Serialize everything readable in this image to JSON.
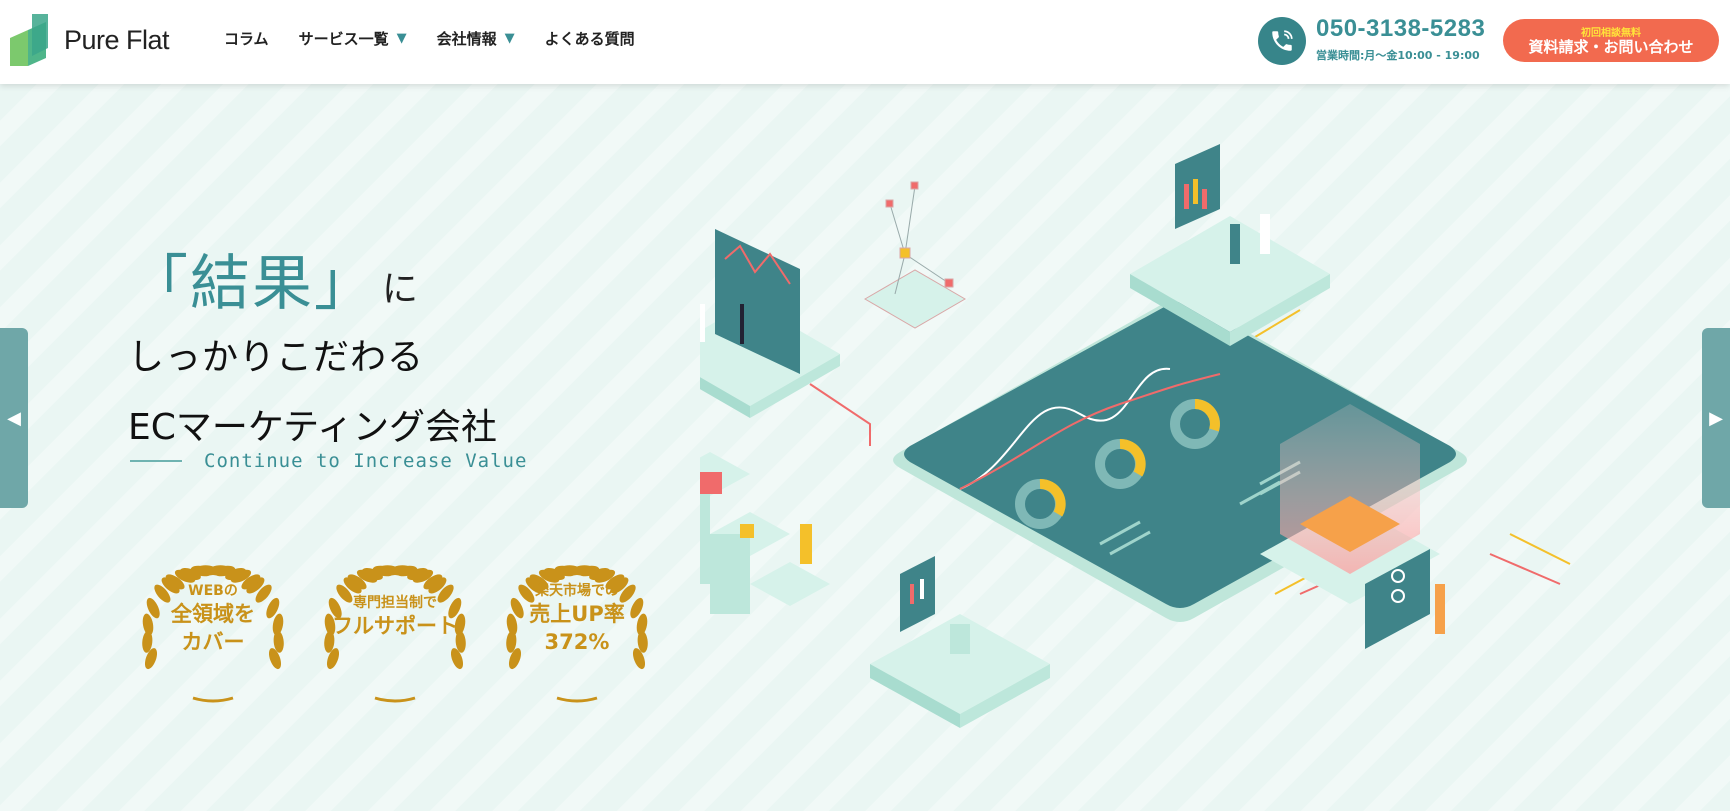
{
  "brand": {
    "name": "Pure Flat"
  },
  "nav": {
    "items": [
      {
        "label": "コラム",
        "caret": false
      },
      {
        "label": "サービス一覧",
        "caret": true
      },
      {
        "label": "会社情報",
        "caret": true
      },
      {
        "label": "よくある質問",
        "caret": false
      }
    ],
    "caret_glyph": "▼"
  },
  "contact": {
    "phone": "050-3138-5283",
    "hours": "営業時間:月～金10:00 - 19:00",
    "cta_sub": "初回相談無料",
    "cta_main": "資料請求・お問い合わせ"
  },
  "hero": {
    "headline_emph": "「結果」",
    "headline_ni": "に",
    "headline_line2": "しっかりこだわる",
    "headline_line3": "ECマーケティング会社",
    "tagline": "Continue to Increase Value",
    "badges": [
      {
        "small": "WEBの",
        "big1": "全領域を",
        "big2": "カバー"
      },
      {
        "small": "専門担当制で",
        "big1": "フルサポート",
        "big2": ""
      },
      {
        "small": "楽天市場での",
        "big1": "売上UP率",
        "big2": "372%"
      }
    ]
  },
  "slider": {
    "prev": "◀",
    "next": "▶"
  },
  "colors": {
    "teal": "#3a8f95",
    "accent": "#f26a4f",
    "gold": "#c9921a",
    "bg": "#eaf6f3"
  }
}
